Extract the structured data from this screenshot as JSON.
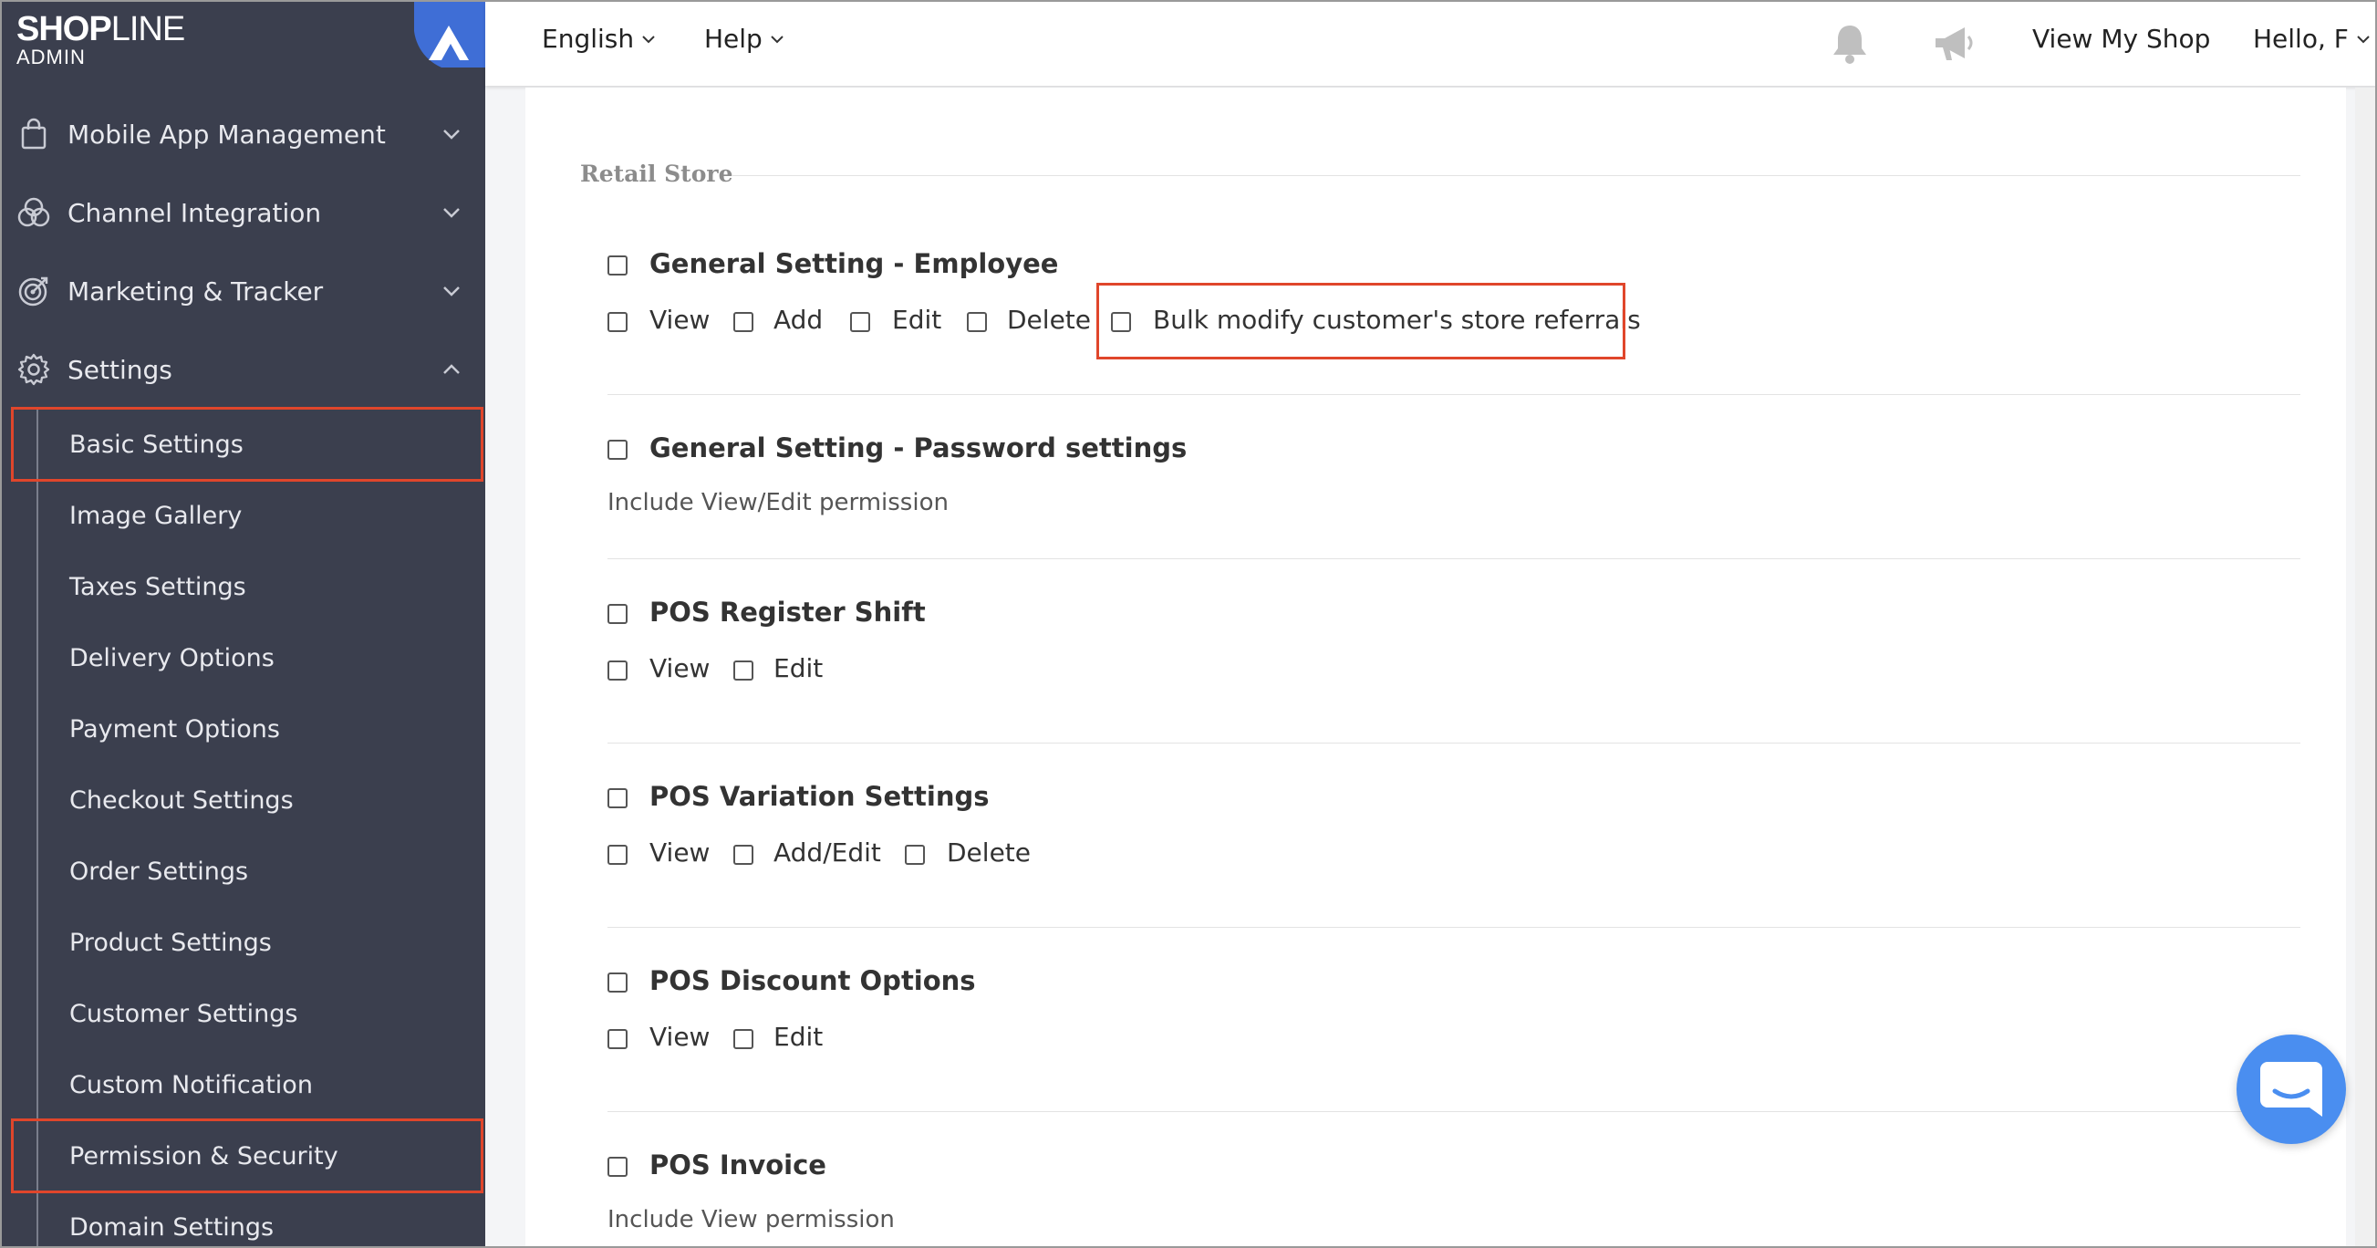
{
  "brand": {
    "name_bold": "SHOP",
    "name_rest": "LINE",
    "sub": "ADMIN"
  },
  "sidebar": {
    "sections": [
      {
        "label": "Mobile App Management",
        "icon": "shopping-bag-icon"
      },
      {
        "label": "Channel Integration",
        "icon": "channel-circles-icon"
      },
      {
        "label": "Marketing & Tracker",
        "icon": "target-icon"
      },
      {
        "label": "Settings",
        "icon": "gear-icon"
      }
    ],
    "settings_items": [
      "Basic Settings",
      "Image Gallery",
      "Taxes Settings",
      "Delivery Options",
      "Payment Options",
      "Checkout Settings",
      "Order Settings",
      "Product Settings",
      "Customer Settings",
      "Custom Notification",
      "Permission & Security",
      "Domain Settings"
    ]
  },
  "topbar": {
    "language": "English",
    "help": "Help",
    "view_shop": "View My Shop",
    "greeting": "Hello, F"
  },
  "content": {
    "section_title": "Retail Store",
    "permissions": [
      {
        "title": "General Setting - Employee",
        "options": [
          "View",
          "Add",
          "Edit",
          "Delete",
          "Bulk modify customer's store referrals"
        ]
      },
      {
        "title": "General Setting - Password settings",
        "note": "Include View/Edit permission"
      },
      {
        "title": "POS Register Shift",
        "options": [
          "View",
          "Edit"
        ]
      },
      {
        "title": "POS Variation Settings",
        "options": [
          "View",
          "Add/Edit",
          "Delete"
        ]
      },
      {
        "title": "POS Discount Options",
        "options": [
          "View",
          "Edit"
        ]
      },
      {
        "title": "POS Invoice",
        "note": "Include View permission"
      }
    ]
  },
  "colors": {
    "sidebar_bg": "#3b3f4e",
    "highlight": "#e0462b",
    "chat_button": "#4a8ef0"
  }
}
